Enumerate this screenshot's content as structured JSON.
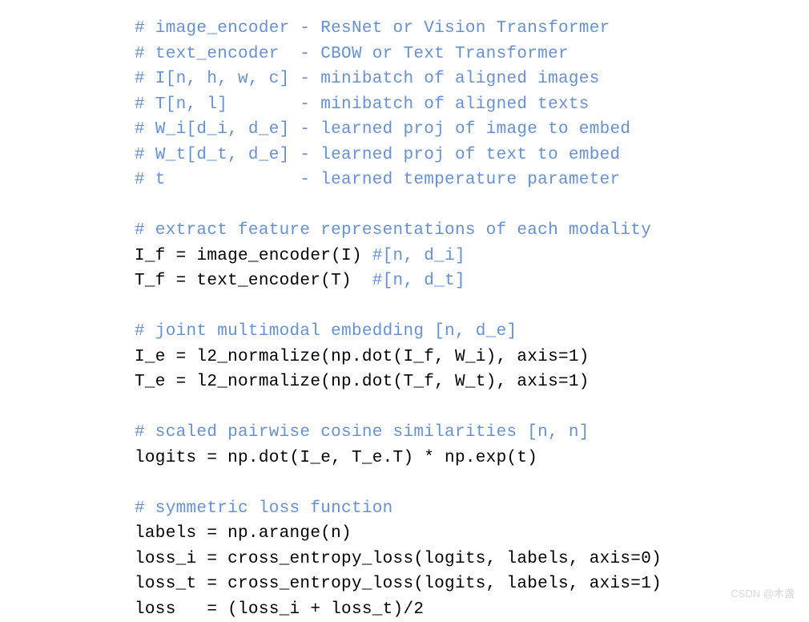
{
  "lines": [
    {
      "type": "comment",
      "text": "# image_encoder - ResNet or Vision Transformer"
    },
    {
      "type": "comment",
      "text": "# text_encoder  - CBOW or Text Transformer"
    },
    {
      "type": "comment",
      "text": "# I[n, h, w, c] - minibatch of aligned images"
    },
    {
      "type": "comment",
      "text": "# T[n, l]       - minibatch of aligned texts"
    },
    {
      "type": "comment",
      "text": "# W_i[d_i, d_e] - learned proj of image to embed"
    },
    {
      "type": "comment",
      "text": "# W_t[d_t, d_e] - learned proj of text to embed"
    },
    {
      "type": "comment",
      "text": "# t             - learned temperature parameter"
    },
    {
      "type": "blank",
      "text": ""
    },
    {
      "type": "comment",
      "text": "# extract feature representations of each modality"
    },
    {
      "type": "mixed",
      "code": "I_f = image_encoder(I) ",
      "comment": "#[n, d_i]"
    },
    {
      "type": "mixed",
      "code": "T_f = text_encoder(T)  ",
      "comment": "#[n, d_t]"
    },
    {
      "type": "blank",
      "text": ""
    },
    {
      "type": "comment",
      "text": "# joint multimodal embedding [n, d_e]"
    },
    {
      "type": "code",
      "text": "I_e = l2_normalize(np.dot(I_f, W_i), axis=1)"
    },
    {
      "type": "code",
      "text": "T_e = l2_normalize(np.dot(T_f, W_t), axis=1)"
    },
    {
      "type": "blank",
      "text": ""
    },
    {
      "type": "comment",
      "text": "# scaled pairwise cosine similarities [n, n]"
    },
    {
      "type": "code",
      "text": "logits = np.dot(I_e, T_e.T) * np.exp(t)"
    },
    {
      "type": "blank",
      "text": ""
    },
    {
      "type": "comment",
      "text": "# symmetric loss function"
    },
    {
      "type": "code",
      "text": "labels = np.arange(n)"
    },
    {
      "type": "code",
      "text": "loss_i = cross_entropy_loss(logits, labels, axis=0)"
    },
    {
      "type": "code",
      "text": "loss_t = cross_entropy_loss(logits, labels, axis=1)"
    },
    {
      "type": "code",
      "text": "loss   = (loss_i + loss_t)/2"
    }
  ],
  "watermark": "CSDN @木盏"
}
